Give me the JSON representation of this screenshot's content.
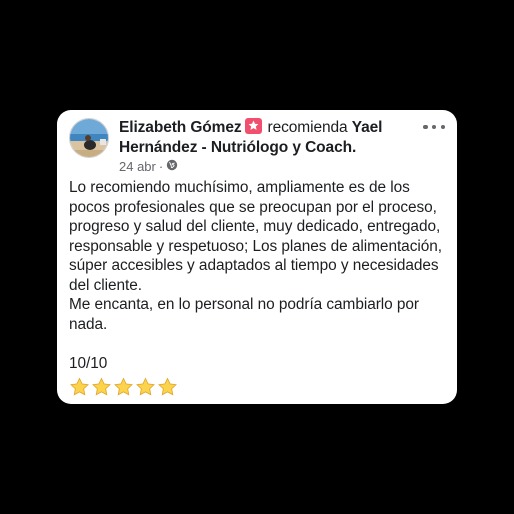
{
  "post": {
    "author": "Elizabeth Gómez",
    "action": "recomienda",
    "page_name": "Yael Hernández - Nutriólogo y Coach.",
    "date": "24 abr",
    "separator": "·",
    "body": "Lo recomiendo muchísimo, ampliamente es de los pocos profesionales que se preocupan por el proceso, progreso y salud del cliente, muy dedicado, entregado, responsable y respetuoso; Los planes de alimentación, súper accesibles y adaptados al tiempo y necesidades del cliente.\nMe encanta, en lo personal no podría cambiarlo por nada.\n\n10/10",
    "stars": "⭐⭐⭐⭐⭐",
    "audience_icon": "globe-icon",
    "recommend_icon": "recommendation-star-icon",
    "menu_icon": "more-options-icon"
  },
  "colors": {
    "background": "#000000",
    "card": "#ffffff",
    "text": "#1c1e21",
    "meta": "#65676b",
    "recommend_badge": "#f0506e"
  }
}
